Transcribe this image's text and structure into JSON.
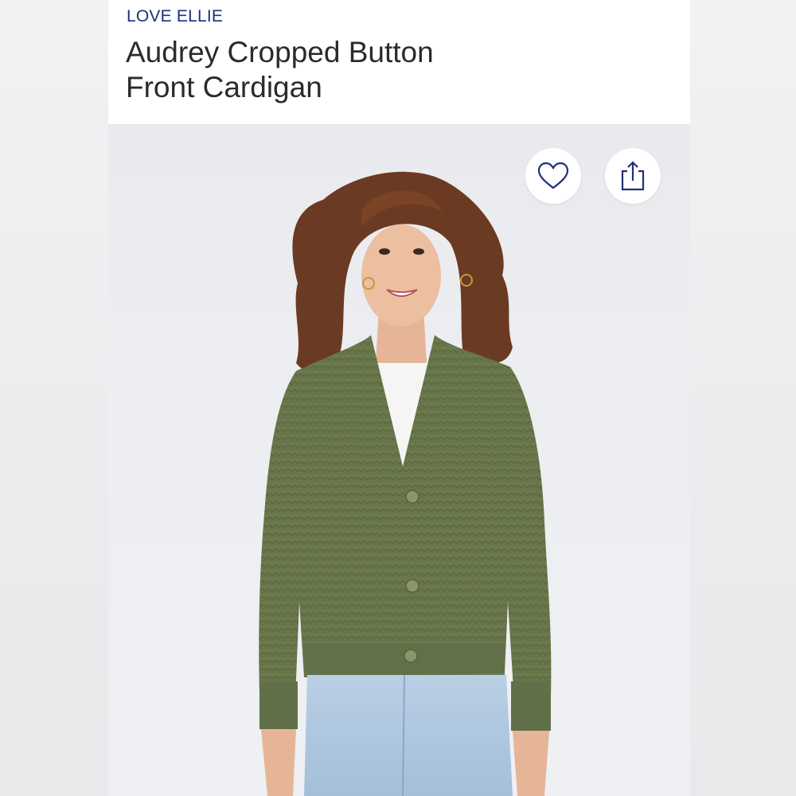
{
  "product": {
    "brand": "LOVE ELLIE",
    "title_line1": "Audrey Cropped Button",
    "title_line2": "Front Cardigan"
  },
  "actions": {
    "favorite_icon": "heart-icon",
    "share_icon": "share-icon"
  },
  "colors": {
    "brand": "#1f2f7a",
    "title": "#2b2b2b",
    "sweater": "#6f7d4e",
    "jeans": "#a9c3dd"
  }
}
